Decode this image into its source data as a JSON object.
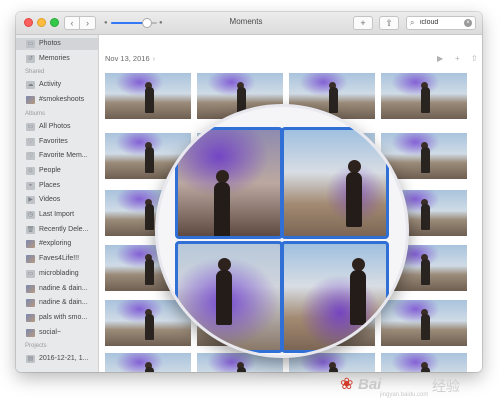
{
  "window": {
    "title": "Moments"
  },
  "toolbar": {
    "back_glyph": "‹",
    "forward_glyph": "›",
    "add_glyph": "+",
    "share_glyph": "⇧",
    "search": {
      "value": "icloud",
      "placeholder": "Search"
    }
  },
  "sidebar": {
    "items_top": [
      {
        "label": "Photos",
        "icon": "photos-icon",
        "selected": true
      },
      {
        "label": "Memories",
        "icon": "memories-icon",
        "selected": false
      }
    ],
    "shared_header": "Shared",
    "shared": [
      {
        "label": "Activity",
        "icon": "cloud-icon"
      },
      {
        "label": "#smokeshoots",
        "icon": "album-thumb-icon"
      }
    ],
    "albums_header": "Albums",
    "albums": [
      {
        "label": "All Photos",
        "icon": "album-icon"
      },
      {
        "label": "Favorites",
        "icon": "heart-icon"
      },
      {
        "label": "Favorite Mem...",
        "icon": "heart-icon"
      },
      {
        "label": "People",
        "icon": "person-icon"
      },
      {
        "label": "Places",
        "icon": "pin-icon"
      },
      {
        "label": "Videos",
        "icon": "video-icon"
      },
      {
        "label": "Last Import",
        "icon": "clock-icon"
      },
      {
        "label": "Recently Dele...",
        "icon": "trash-icon"
      },
      {
        "label": "#exploring",
        "icon": "album-thumb-icon"
      },
      {
        "label": "Faves4Life!!!",
        "icon": "album-thumb-icon"
      },
      {
        "label": "microblading",
        "icon": "album-icon"
      },
      {
        "label": "nadine & dain...",
        "icon": "album-thumb-icon"
      },
      {
        "label": "nadine & dain...",
        "icon": "album-thumb-icon"
      },
      {
        "label": "pals with smo...",
        "icon": "album-thumb-icon"
      },
      {
        "label": "social~",
        "icon": "album-thumb-icon"
      }
    ],
    "projects_header": "Projects",
    "projects": [
      {
        "label": "2016-12-21, 1...",
        "icon": "project-icon"
      }
    ]
  },
  "main": {
    "date_label": "Nov 13, 2016",
    "date_chevron": "›",
    "play_glyph": "▶",
    "add_glyph": "+",
    "share_glyph": "⇧"
  },
  "watermark": {
    "brand": "Bai",
    "brand2": "经验",
    "url": "jingyan.baidu.com"
  },
  "colors": {
    "accent": "#3478f6",
    "selection_border": "#2f6fd6",
    "smoke": "#7a46d2"
  }
}
